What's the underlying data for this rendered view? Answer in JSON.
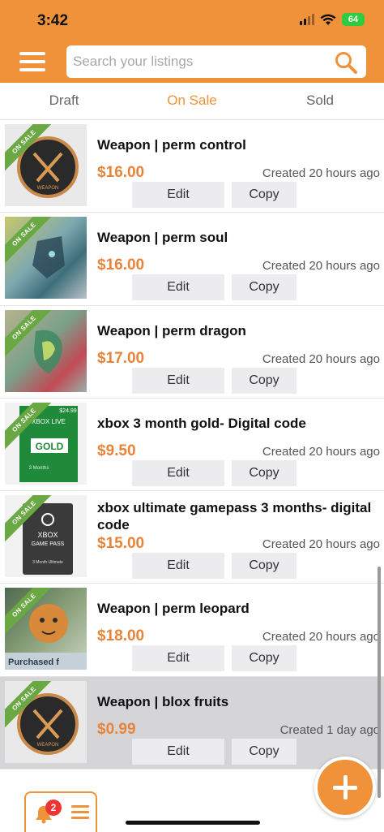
{
  "status_bar": {
    "time": "3:42",
    "battery": "64"
  },
  "search": {
    "placeholder": "Search your listings",
    "value": ""
  },
  "tabs": [
    {
      "label": "Draft",
      "active": false
    },
    {
      "label": "On Sale",
      "active": true
    },
    {
      "label": "Sold",
      "active": false
    }
  ],
  "badge_text": "ON SALE",
  "listings": [
    {
      "title": "Weapon | perm control",
      "price": "$16.00",
      "created": "Created 20 hours ago",
      "edit": "Edit",
      "copy": "Copy"
    },
    {
      "title": "Weapon | perm soul",
      "price": "$16.00",
      "created": "Created 20 hours ago",
      "edit": "Edit",
      "copy": "Copy"
    },
    {
      "title": "Weapon | perm dragon",
      "price": "$17.00",
      "created": "Created 20 hours ago",
      "edit": "Edit",
      "copy": "Copy"
    },
    {
      "title": "xbox 3 month gold- Digital code",
      "price": "$9.50",
      "created": "Created 20 hours ago",
      "edit": "Edit",
      "copy": "Copy"
    },
    {
      "title": "xbox ultimate gamepass 3 months- digital code",
      "price": "$15.00",
      "created": "Created 20 hours ago",
      "edit": "Edit",
      "copy": "Copy"
    },
    {
      "title": "Weapon | perm leopard",
      "price": "$18.00",
      "created": "Created 20 hours ago",
      "edit": "Edit",
      "copy": "Copy"
    },
    {
      "title": "Weapon | blox fruits",
      "price": "$0.99",
      "created": "Created 1 day ago",
      "edit": "Edit",
      "copy": "Copy"
    }
  ],
  "thumbnail_text": {
    "weapon": "WEAPON",
    "xbox_live": "XBOX LIVE",
    "gold": "GOLD",
    "gold_price": "$24.99",
    "gold_months": "3 Months",
    "gamepass_xbox": "XBOX",
    "gamepass_name": "GAME PASS",
    "gamepass_plan": "3 Month Ultimate",
    "leopard_caption": "Purchased f"
  },
  "bottom_bar": {
    "notification_count": "2"
  },
  "colors": {
    "brand": "#f0923a",
    "price": "#e8843a",
    "badge": "#6aa844",
    "active_tab": "#f0923a"
  },
  "icons": [
    "hamburger-menu-icon",
    "search-icon",
    "plus-icon",
    "bell-icon",
    "list-menu-icon"
  ]
}
